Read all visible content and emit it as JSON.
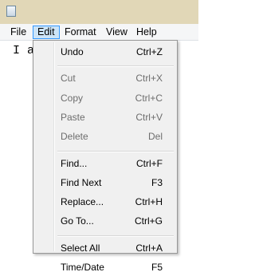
{
  "menubar": [
    {
      "label": "File",
      "active": false
    },
    {
      "label": "Edit",
      "active": true
    },
    {
      "label": "Format",
      "active": false
    },
    {
      "label": "View",
      "active": false
    },
    {
      "label": "Help",
      "active": false
    }
  ],
  "editor": {
    "visible_text": "I a"
  },
  "edit_menu": [
    {
      "label": "Undo",
      "shortcut": "Ctrl+Z",
      "enabled": true
    },
    {
      "separator": true
    },
    {
      "label": "Cut",
      "shortcut": "Ctrl+X",
      "enabled": false
    },
    {
      "label": "Copy",
      "shortcut": "Ctrl+C",
      "enabled": false
    },
    {
      "label": "Paste",
      "shortcut": "Ctrl+V",
      "enabled": false
    },
    {
      "label": "Delete",
      "shortcut": "Del",
      "enabled": false
    },
    {
      "separator": true
    },
    {
      "label": "Find...",
      "shortcut": "Ctrl+F",
      "enabled": true
    },
    {
      "label": "Find Next",
      "shortcut": "F3",
      "enabled": true
    },
    {
      "label": "Replace...",
      "shortcut": "Ctrl+H",
      "enabled": true
    },
    {
      "label": "Go To...",
      "shortcut": "Ctrl+G",
      "enabled": true
    },
    {
      "separator": true
    },
    {
      "label": "Select All",
      "shortcut": "Ctrl+A",
      "enabled": true
    },
    {
      "label": "Time/Date",
      "shortcut": "F5",
      "enabled": true
    }
  ],
  "icons": {
    "app": "notepad-icon"
  },
  "colors": {
    "titlebar": "#e1d7b7",
    "menu_highlight": "#cce4f7",
    "menu_highlight_border": "#3399ff",
    "disabled_text": "#6d6d6d"
  }
}
